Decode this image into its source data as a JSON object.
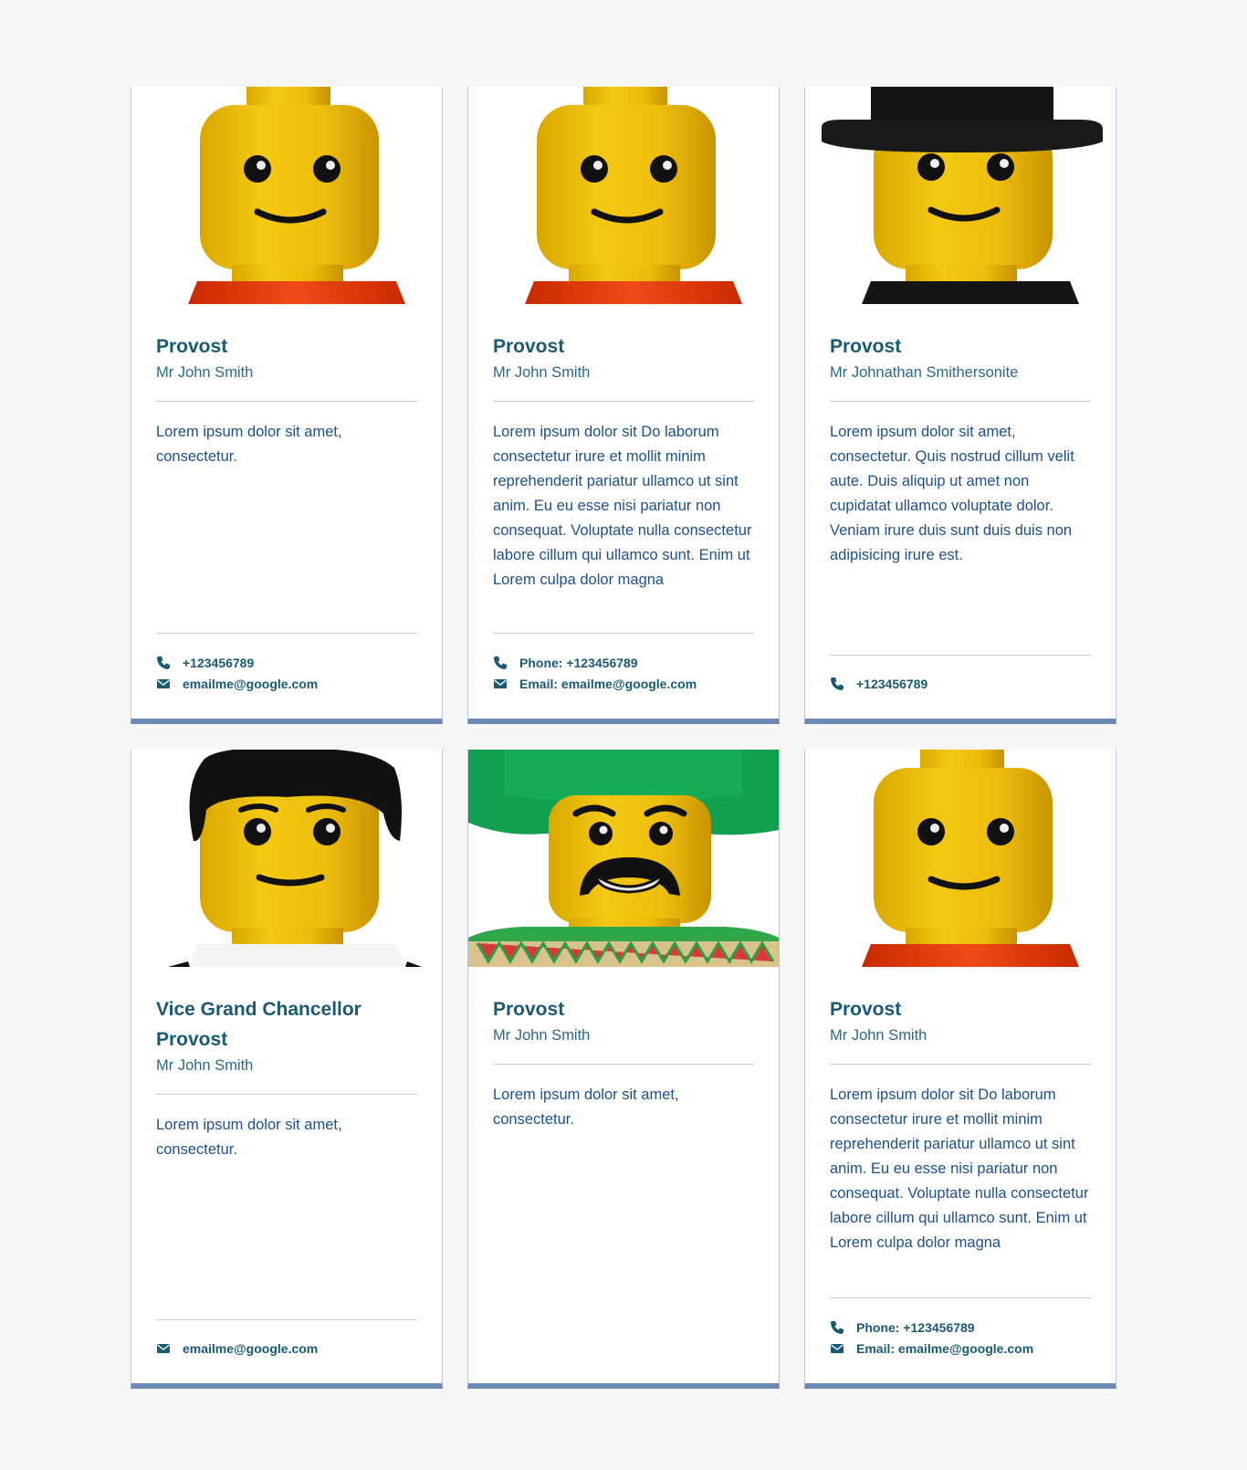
{
  "colors": {
    "page_bg": "#f6f6f6",
    "card_accent": "#6a89b4",
    "role_text": "#1a5a72",
    "name_text": "#2a6a86",
    "description_text": "#1f4f88",
    "lego_yellow": "#e8b80a",
    "lego_red": "#e03a10"
  },
  "cards": [
    {
      "portrait": "lego-head-plain-red-torso",
      "role": "Provost",
      "name": "Mr John Smith",
      "description": "Lorem ipsum dolor sit amet, consectetur.",
      "phone": "+123456789",
      "email": "emailme@google.com"
    },
    {
      "portrait": "lego-head-plain-red-torso",
      "role": "Provost",
      "name": "Mr John Smith",
      "description": "Lorem ipsum dolor sit Do laborum consectetur irure et mollit minim reprehenderit pariatur ullamco ut sint anim. Eu eu esse nisi pariatur non consequat. Voluptate nulla consectetur labore cillum qui ullamco sunt. Enim ut Lorem culpa dolor magna",
      "phone": "Phone: +123456789",
      "email": "Email: emailme@google.com"
    },
    {
      "portrait": "lego-head-top-hat-black-torso",
      "role": "Provost",
      "name": "Mr Johnathan Smithersonite",
      "description": "Lorem ipsum dolor sit amet, consectetur. Quis nostrud cillum velit aute. Duis aliquip ut amet non cupidatat ullamco voluptate dolor. Veniam irure duis sunt duis duis non adipisicing irure est.",
      "phone": "+123456789",
      "email": null
    },
    {
      "portrait": "lego-head-black-hair-white-torso",
      "role": "Vice Grand Chancellor Provost",
      "name": "Mr John Smith",
      "description": "Lorem ipsum dolor sit amet, consectetur.",
      "phone": null,
      "email": "emailme@google.com"
    },
    {
      "portrait": "lego-head-sombrero-mustache-poncho",
      "role": "Provost",
      "name": "Mr John Smith",
      "description": "Lorem ipsum dolor sit amet, consectetur.",
      "phone": null,
      "email": null
    },
    {
      "portrait": "lego-head-plain-red-torso",
      "role": "Provost",
      "name": "Mr John Smith",
      "description": "Lorem ipsum dolor sit Do laborum consectetur irure et mollit minim reprehenderit pariatur ullamco ut sint anim. Eu eu esse nisi pariatur non consequat. Voluptate nulla consectetur labore cillum qui ullamco sunt. Enim ut Lorem culpa dolor magna",
      "phone": "Phone: +123456789",
      "email": "Email: emailme@google.com"
    }
  ]
}
